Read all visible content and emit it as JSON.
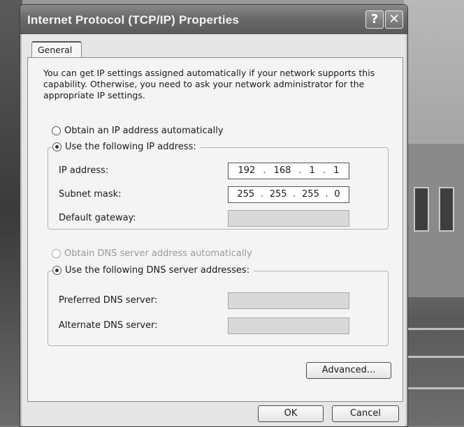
{
  "window": {
    "title": "Internet Protocol (TCP/IP) Properties",
    "help_glyph": "?",
    "close_glyph": "✕"
  },
  "tabs": [
    {
      "label": "General",
      "selected": true
    }
  ],
  "intro_text": "You can get IP settings assigned automatically if your network supports this capability. Otherwise, you need to ask your network administrator for the appropriate IP settings.",
  "ip_section": {
    "auto_option": {
      "label": "Obtain an IP address automatically",
      "selected": false
    },
    "manual_option": {
      "label": "Use the following IP address:",
      "selected": true
    },
    "fields": [
      {
        "label": "IP address:",
        "octets": [
          "192",
          "168",
          "1",
          "1"
        ],
        "enabled": true
      },
      {
        "label": "Subnet mask:",
        "octets": [
          "255",
          "255",
          "255",
          "0"
        ],
        "enabled": true
      },
      {
        "label": "Default gateway:",
        "octets": [
          "",
          "",
          "",
          ""
        ],
        "enabled": false
      }
    ]
  },
  "dns_section": {
    "auto_option": {
      "label": "Obtain DNS server address automatically",
      "selected": false,
      "enabled": false
    },
    "manual_option": {
      "label": "Use the following DNS server addresses:",
      "selected": true
    },
    "fields": [
      {
        "label": "Preferred DNS server:",
        "enabled": false
      },
      {
        "label": "Alternate DNS server:",
        "enabled": false
      }
    ]
  },
  "buttons": {
    "advanced": "Advanced...",
    "ok": "OK",
    "cancel": "Cancel"
  }
}
